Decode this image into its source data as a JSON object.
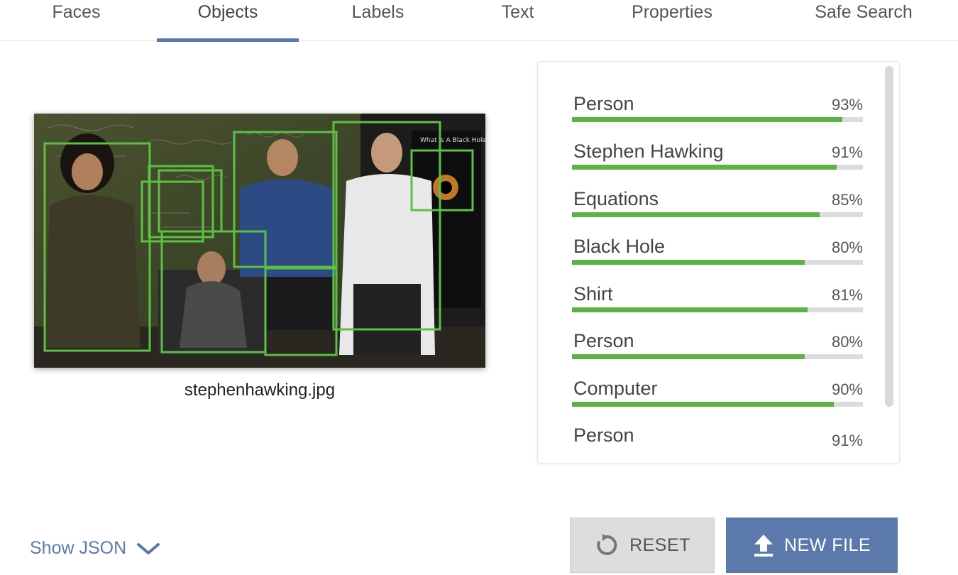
{
  "tabs": [
    {
      "label": "Faces"
    },
    {
      "label": "Objects"
    },
    {
      "label": "Labels"
    },
    {
      "label": "Text"
    },
    {
      "label": "Properties"
    },
    {
      "label": "Safe Search"
    }
  ],
  "active_tab": "Objects",
  "image": {
    "filename": "stephenhawking.jpg",
    "blackboard_text": "What is A Black Hole?"
  },
  "results": [
    {
      "label": "Person",
      "percent": "93%",
      "score": 0.93
    },
    {
      "label": "Stephen Hawking",
      "percent": "91%",
      "score": 0.91
    },
    {
      "label": "Equations",
      "percent": "85%",
      "score": 0.85
    },
    {
      "label": "Black Hole",
      "percent": "80%",
      "score": 0.8
    },
    {
      "label": "Shirt",
      "percent": "81%",
      "score": 0.81
    },
    {
      "label": "Person",
      "percent": "80%",
      "score": 0.8
    },
    {
      "label": "Computer",
      "percent": "90%",
      "score": 0.9
    },
    {
      "label": "Person",
      "percent": "91%",
      "score": 0.91
    }
  ],
  "show_json_label": "Show JSON",
  "buttons": {
    "reset_label": "RESET",
    "new_file_label": "NEW FILE"
  },
  "colors": {
    "accent": "#5b79ab",
    "bar_fill": "#5cb245",
    "bar_track": "#dcdcdc",
    "box_stroke": "#5cc043"
  },
  "icons": {
    "reset": "reset-arrow-icon",
    "upload": "upload-arrow-icon",
    "expand": "chevron-down-icon"
  }
}
